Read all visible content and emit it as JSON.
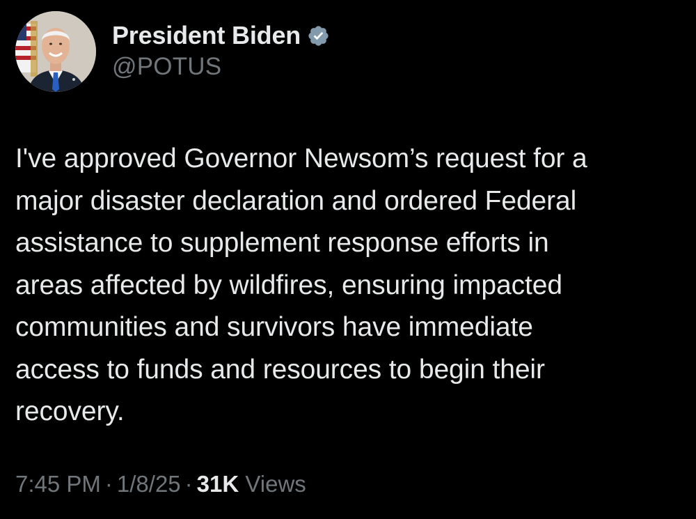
{
  "author": {
    "display_name": "President Biden",
    "handle": "@POTUS",
    "verified_badge_color": "#829aab",
    "avatar_icon": "profile-photo"
  },
  "tweet": {
    "lines": [
      "I've approved Governor Newsom’s request for a",
      "major disaster declaration and ordered Federal",
      "assistance to supplement response efforts in",
      "areas affected by wildfires, ensuring impacted",
      "communities and survivors have immediate",
      "access to funds and resources to begin their",
      "recovery."
    ]
  },
  "meta": {
    "time": "7:45 PM",
    "separator": "·",
    "date": "1/8/25",
    "views_count": "31K",
    "views_label": "Views"
  },
  "colors": {
    "background": "#000000",
    "primary_text": "#e7e9ea",
    "secondary_text": "#71767b"
  }
}
